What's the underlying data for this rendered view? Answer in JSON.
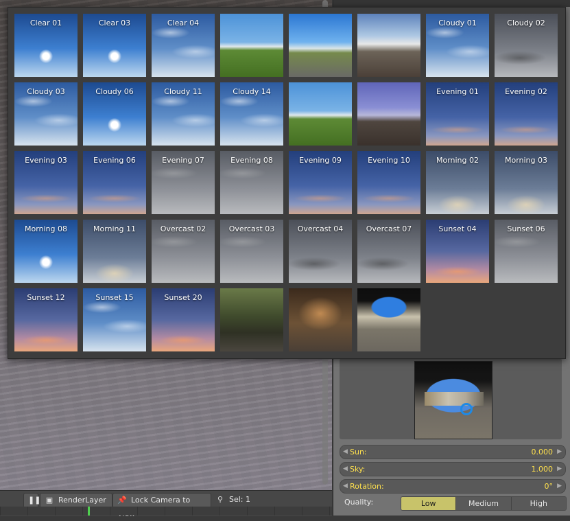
{
  "popup": {
    "thumbnails": [
      {
        "label": "Clear 01",
        "style": "clear"
      },
      {
        "label": "Clear 03",
        "style": "clear"
      },
      {
        "label": "Clear 04",
        "style": "cloudy"
      },
      {
        "label": "",
        "style": "field-photo"
      },
      {
        "label": "",
        "style": "road"
      },
      {
        "label": "",
        "style": "pano"
      },
      {
        "label": "Cloudy 01",
        "style": "cloudy"
      },
      {
        "label": "Cloudy 02",
        "style": "grey"
      },
      {
        "label": "Cloudy 03",
        "style": "cloudy"
      },
      {
        "label": "Cloudy 06",
        "style": "clear"
      },
      {
        "label": "Cloudy 11",
        "style": "cloudy"
      },
      {
        "label": "Cloudy 14",
        "style": "cloudy"
      },
      {
        "label": "",
        "style": "field-photo"
      },
      {
        "label": "",
        "style": "dusk-field"
      },
      {
        "label": "Evening 01",
        "style": "evening"
      },
      {
        "label": "Evening 02",
        "style": "evening"
      },
      {
        "label": "Evening 03",
        "style": "evening"
      },
      {
        "label": "Evening 06",
        "style": "evening"
      },
      {
        "label": "Evening 07",
        "style": "overcast"
      },
      {
        "label": "Evening 08",
        "style": "overcast"
      },
      {
        "label": "Evening 09",
        "style": "evening"
      },
      {
        "label": "Evening 10",
        "style": "evening"
      },
      {
        "label": "Morning 02",
        "style": "morning"
      },
      {
        "label": "Morning 03",
        "style": "morning"
      },
      {
        "label": "Morning 08",
        "style": "clear"
      },
      {
        "label": "Morning 11",
        "style": "morning"
      },
      {
        "label": "Overcast 02",
        "style": "overcast"
      },
      {
        "label": "Overcast 03",
        "style": "overcast"
      },
      {
        "label": "Overcast 04",
        "style": "grey"
      },
      {
        "label": "Overcast 07",
        "style": "grey"
      },
      {
        "label": "Sunset 04",
        "style": "sunset"
      },
      {
        "label": "Sunset 06",
        "style": "overcast"
      },
      {
        "label": "Sunset 12",
        "style": "sunset"
      },
      {
        "label": "Sunset 15",
        "style": "cloudy"
      },
      {
        "label": "Sunset 20",
        "style": "sunset"
      },
      {
        "label": "",
        "style": "forest"
      },
      {
        "label": "",
        "style": "arch"
      },
      {
        "label": "",
        "style": "courtyard"
      }
    ]
  },
  "properties": {
    "sun_label": "Sun:",
    "sun_value": "0.000",
    "sky_label": "Sky:",
    "sky_value": "1.000",
    "rotation_label": "Rotation:",
    "rotation_value": "0°",
    "quality_label": "Quality:",
    "quality_options": [
      "Low",
      "Medium",
      "High"
    ],
    "quality_selected": "Low"
  },
  "bottombar": {
    "pause_icon": "pause-icon",
    "render_layer_label": "RenderLayer",
    "lock_camera_label": "Lock Camera to View",
    "sel_label": "Sel: 1"
  },
  "colors": {
    "value_text": "#ffe14d",
    "selected_option": "#c8c36a"
  }
}
